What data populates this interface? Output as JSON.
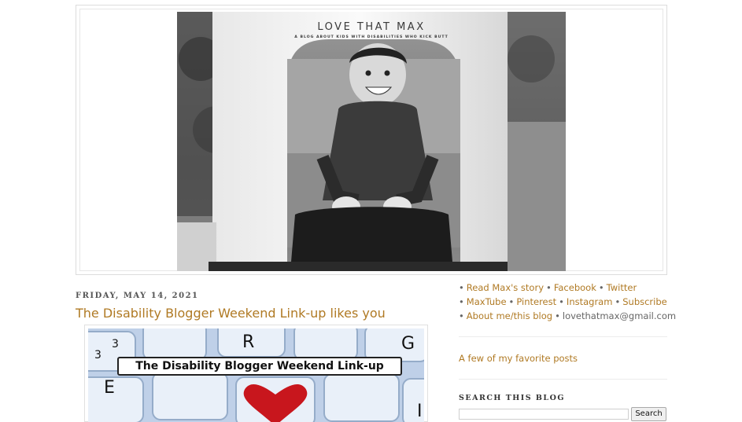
{
  "header": {
    "blog_title": "LOVE THAT MAX",
    "blog_description": "A BLOG ABOUT KIDS WITH DISABILITIES WHO KICK BUTT",
    "photo_name": "header-photo"
  },
  "post": {
    "date": "FRIDAY, MAY 14, 2021",
    "title": "The Disability Blogger Weekend Link-up likes you",
    "image_banner_text": "The Disability Blogger Weekend Link-up"
  },
  "sidebar": {
    "links_row1": [
      {
        "label": "Read Max's story"
      },
      {
        "label": "Facebook"
      },
      {
        "label": "Twitter"
      }
    ],
    "links_row2": [
      {
        "label": "MaxTube"
      },
      {
        "label": "Pinterest"
      },
      {
        "label": "Instagram"
      },
      {
        "label": "Subscribe"
      }
    ],
    "links_row3": [
      {
        "label": "About me/this blog"
      }
    ],
    "email": "lovethatmax@gmail.com",
    "bullet": "•",
    "favorite_posts_label": "A few of my favorite posts",
    "search_heading": "SEARCH THIS BLOG",
    "search_placeholder": "",
    "search_button_label": "Search"
  },
  "colors": {
    "link": "#b07a24",
    "text": "#555555"
  }
}
